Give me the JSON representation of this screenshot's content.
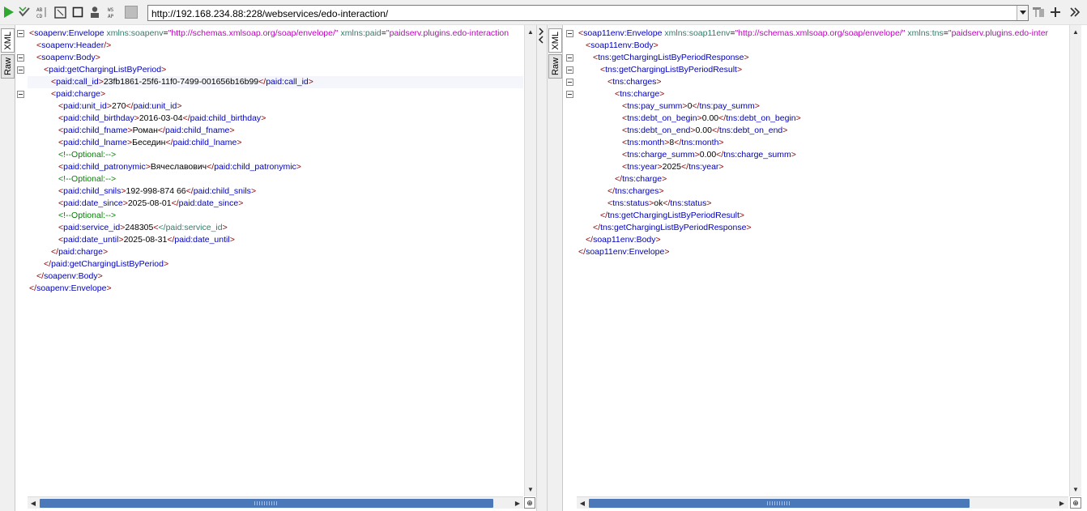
{
  "toolbar": {
    "url": "http://192.168.234.88:228/webservices/edo-interaction/",
    "icons": [
      "play-icon",
      "check-validate-icon",
      "format-icon",
      "fullscreen-icon",
      "stop-icon",
      "user-auth-icon",
      "wsa-icon",
      "wsdl-icon",
      "options-icon",
      "add-icon",
      "scroll-right-icon"
    ]
  },
  "request": {
    "tabs": [
      "XML",
      "Raw"
    ],
    "lines": [
      {
        "indent": 0,
        "parts": [
          [
            "t",
            "<"
          ],
          [
            "n",
            "soapenv:Envelope"
          ],
          [
            "a",
            " xmlns:soapenv"
          ],
          [
            "x",
            "="
          ],
          [
            "v",
            "\"http://schemas.xmlsoap.org/soap/envelope/\""
          ],
          [
            "a",
            " xmlns:paid"
          ],
          [
            "x",
            "="
          ],
          [
            "v",
            "\"paidserv.plugins.edo-interaction"
          ]
        ]
      },
      {
        "indent": 1,
        "parts": [
          [
            "t",
            "<"
          ],
          [
            "n",
            "soapenv:Header"
          ],
          [
            "t",
            "/>"
          ]
        ]
      },
      {
        "indent": 1,
        "parts": [
          [
            "t",
            "<"
          ],
          [
            "n",
            "soapenv:Body"
          ],
          [
            "t",
            ">"
          ]
        ]
      },
      {
        "indent": 2,
        "parts": [
          [
            "t",
            "<"
          ],
          [
            "n",
            "paid:getChargingListByPeriod"
          ],
          [
            "t",
            ">"
          ]
        ]
      },
      {
        "indent": 3,
        "parts": [
          [
            "t",
            "<"
          ],
          [
            "n",
            "paid:call_id"
          ],
          [
            "t",
            ">"
          ],
          [
            "x",
            "23fb1861-25f6-11f0-7499-001656b16b99"
          ],
          [
            "t",
            "</"
          ],
          [
            "n",
            "paid:call_id"
          ],
          [
            "t",
            ">"
          ]
        ]
      },
      {
        "indent": 3,
        "parts": [
          [
            "t",
            "<"
          ],
          [
            "n",
            "paid:charge"
          ],
          [
            "t",
            ">"
          ]
        ]
      },
      {
        "indent": 4,
        "parts": [
          [
            "t",
            "<"
          ],
          [
            "n",
            "paid:unit_id"
          ],
          [
            "t",
            ">"
          ],
          [
            "x",
            "270"
          ],
          [
            "t",
            "</"
          ],
          [
            "n",
            "paid:unit_id"
          ],
          [
            "t",
            ">"
          ]
        ]
      },
      {
        "indent": 4,
        "parts": [
          [
            "t",
            "<"
          ],
          [
            "n",
            "paid:child_birthday"
          ],
          [
            "t",
            ">"
          ],
          [
            "x",
            "2016-03-04"
          ],
          [
            "t",
            "</"
          ],
          [
            "n",
            "paid:child_birthday"
          ],
          [
            "t",
            ">"
          ]
        ]
      },
      {
        "indent": 4,
        "parts": [
          [
            "t",
            "<"
          ],
          [
            "n",
            "paid:child_fname"
          ],
          [
            "t",
            ">"
          ],
          [
            "x",
            "Роман"
          ],
          [
            "t",
            "</"
          ],
          [
            "n",
            "paid:child_fname"
          ],
          [
            "t",
            ">"
          ]
        ]
      },
      {
        "indent": 4,
        "parts": [
          [
            "t",
            "<"
          ],
          [
            "n",
            "paid:child_lname"
          ],
          [
            "t",
            ">"
          ],
          [
            "x",
            "Беседин"
          ],
          [
            "t",
            "</"
          ],
          [
            "n",
            "paid:child_lname"
          ],
          [
            "t",
            ">"
          ]
        ]
      },
      {
        "indent": 4,
        "parts": [
          [
            "c",
            "<!--Optional:-->"
          ]
        ]
      },
      {
        "indent": 4,
        "parts": [
          [
            "t",
            "<"
          ],
          [
            "n",
            "paid:child_patronymic"
          ],
          [
            "t",
            ">"
          ],
          [
            "x",
            "Вячеславович"
          ],
          [
            "t",
            "</"
          ],
          [
            "n",
            "paid:child_patronymic"
          ],
          [
            "t",
            ">"
          ]
        ]
      },
      {
        "indent": 4,
        "parts": [
          [
            "c",
            "<!--Optional:-->"
          ]
        ]
      },
      {
        "indent": 4,
        "parts": [
          [
            "t",
            "<"
          ],
          [
            "n",
            "paid:child_snils"
          ],
          [
            "t",
            ">"
          ],
          [
            "x",
            "192-998-874 66"
          ],
          [
            "t",
            "</"
          ],
          [
            "n",
            "paid:child_snils"
          ],
          [
            "t",
            ">"
          ]
        ]
      },
      {
        "indent": 4,
        "parts": [
          [
            "t",
            "<"
          ],
          [
            "n",
            "paid:date_since"
          ],
          [
            "t",
            ">"
          ],
          [
            "x",
            "2025-08-01"
          ],
          [
            "t",
            "</"
          ],
          [
            "n",
            "paid:date_since"
          ],
          [
            "t",
            ">"
          ]
        ]
      },
      {
        "indent": 4,
        "parts": [
          [
            "c",
            "<!--Optional:-->"
          ]
        ]
      },
      {
        "indent": 4,
        "parts": [
          [
            "t",
            "<"
          ],
          [
            "n",
            "paid:service_id"
          ],
          [
            "t",
            ">"
          ],
          [
            "x",
            "248305"
          ],
          [
            "t",
            "<"
          ],
          [
            "a",
            "</paid:service_id"
          ],
          [
            "t",
            ">"
          ]
        ]
      },
      {
        "indent": 4,
        "parts": [
          [
            "t",
            "<"
          ],
          [
            "n",
            "paid:date_until"
          ],
          [
            "t",
            ">"
          ],
          [
            "x",
            "2025-08-31"
          ],
          [
            "t",
            "</"
          ],
          [
            "n",
            "paid:date_until"
          ],
          [
            "t",
            ">"
          ]
        ]
      },
      {
        "indent": 3,
        "parts": [
          [
            "t",
            "</"
          ],
          [
            "n",
            "paid:charge"
          ],
          [
            "t",
            ">"
          ]
        ]
      },
      {
        "indent": 2,
        "parts": [
          [
            "t",
            "</"
          ],
          [
            "n",
            "paid:getChargingListByPeriod"
          ],
          [
            "t",
            ">"
          ]
        ]
      },
      {
        "indent": 1,
        "parts": [
          [
            "t",
            "</"
          ],
          [
            "n",
            "soapenv:Body"
          ],
          [
            "t",
            ">"
          ]
        ]
      },
      {
        "indent": 0,
        "parts": [
          [
            "t",
            "</"
          ],
          [
            "n",
            "soapenv:Envelope"
          ],
          [
            "t",
            ">"
          ]
        ]
      }
    ]
  },
  "response": {
    "tabs": [
      "XML",
      "Raw"
    ],
    "lines": [
      {
        "indent": 0,
        "parts": [
          [
            "t",
            "<"
          ],
          [
            "n",
            "soap11env:Envelope"
          ],
          [
            "a",
            " xmlns:soap11env"
          ],
          [
            "x",
            "="
          ],
          [
            "v",
            "\"http://schemas.xmlsoap.org/soap/envelope/\""
          ],
          [
            "a",
            " xmlns:tns"
          ],
          [
            "x",
            "="
          ],
          [
            "v",
            "\"paidserv.plugins.edo-inter"
          ]
        ]
      },
      {
        "indent": 1,
        "parts": [
          [
            "t",
            "<"
          ],
          [
            "n",
            "soap11env:Body"
          ],
          [
            "t",
            ">"
          ]
        ]
      },
      {
        "indent": 2,
        "parts": [
          [
            "t",
            "<"
          ],
          [
            "n",
            "tns:getChargingListByPeriodResponse"
          ],
          [
            "t",
            ">"
          ]
        ]
      },
      {
        "indent": 3,
        "parts": [
          [
            "t",
            "<"
          ],
          [
            "n",
            "tns:getChargingListByPeriodResult"
          ],
          [
            "t",
            ">"
          ]
        ]
      },
      {
        "indent": 4,
        "parts": [
          [
            "t",
            "<"
          ],
          [
            "n",
            "tns:charges"
          ],
          [
            "t",
            ">"
          ]
        ]
      },
      {
        "indent": 5,
        "parts": [
          [
            "t",
            "<"
          ],
          [
            "n",
            "tns:charge"
          ],
          [
            "t",
            ">"
          ]
        ]
      },
      {
        "indent": 6,
        "parts": [
          [
            "t",
            "<"
          ],
          [
            "n",
            "tns:pay_summ"
          ],
          [
            "t",
            ">"
          ],
          [
            "x",
            "0"
          ],
          [
            "t",
            "</"
          ],
          [
            "n",
            "tns:pay_summ"
          ],
          [
            "t",
            ">"
          ]
        ]
      },
      {
        "indent": 6,
        "parts": [
          [
            "t",
            "<"
          ],
          [
            "n",
            "tns:debt_on_begin"
          ],
          [
            "t",
            ">"
          ],
          [
            "x",
            "0.00"
          ],
          [
            "t",
            "</"
          ],
          [
            "n",
            "tns:debt_on_begin"
          ],
          [
            "t",
            ">"
          ]
        ]
      },
      {
        "indent": 6,
        "parts": [
          [
            "t",
            "<"
          ],
          [
            "n",
            "tns:debt_on_end"
          ],
          [
            "t",
            ">"
          ],
          [
            "x",
            "0.00"
          ],
          [
            "t",
            "</"
          ],
          [
            "n",
            "tns:debt_on_end"
          ],
          [
            "t",
            ">"
          ]
        ]
      },
      {
        "indent": 6,
        "parts": [
          [
            "t",
            "<"
          ],
          [
            "n",
            "tns:month"
          ],
          [
            "t",
            ">"
          ],
          [
            "x",
            "8"
          ],
          [
            "t",
            "</"
          ],
          [
            "n",
            "tns:month"
          ],
          [
            "t",
            ">"
          ]
        ]
      },
      {
        "indent": 6,
        "parts": [
          [
            "t",
            "<"
          ],
          [
            "n",
            "tns:charge_summ"
          ],
          [
            "t",
            ">"
          ],
          [
            "x",
            "0.00"
          ],
          [
            "t",
            "</"
          ],
          [
            "n",
            "tns:charge_summ"
          ],
          [
            "t",
            ">"
          ]
        ]
      },
      {
        "indent": 6,
        "parts": [
          [
            "t",
            "<"
          ],
          [
            "n",
            "tns:year"
          ],
          [
            "t",
            ">"
          ],
          [
            "x",
            "2025"
          ],
          [
            "t",
            "</"
          ],
          [
            "n",
            "tns:year"
          ],
          [
            "t",
            ">"
          ]
        ]
      },
      {
        "indent": 5,
        "parts": [
          [
            "t",
            "</"
          ],
          [
            "n",
            "tns:charge"
          ],
          [
            "t",
            ">"
          ]
        ]
      },
      {
        "indent": 4,
        "parts": [
          [
            "t",
            "</"
          ],
          [
            "n",
            "tns:charges"
          ],
          [
            "t",
            ">"
          ]
        ]
      },
      {
        "indent": 4,
        "parts": [
          [
            "t",
            "<"
          ],
          [
            "n",
            "tns:status"
          ],
          [
            "t",
            ">"
          ],
          [
            "x",
            "ok"
          ],
          [
            "t",
            "</"
          ],
          [
            "n",
            "tns:status"
          ],
          [
            "t",
            ">"
          ]
        ]
      },
      {
        "indent": 3,
        "parts": [
          [
            "t",
            "</"
          ],
          [
            "n",
            "tns:getChargingListByPeriodResult"
          ],
          [
            "t",
            ">"
          ]
        ]
      },
      {
        "indent": 2,
        "parts": [
          [
            "t",
            "</"
          ],
          [
            "n",
            "tns:getChargingListByPeriodResponse"
          ],
          [
            "t",
            ">"
          ]
        ]
      },
      {
        "indent": 1,
        "parts": [
          [
            "t",
            "</"
          ],
          [
            "n",
            "soap11env:Body"
          ],
          [
            "t",
            ">"
          ]
        ]
      },
      {
        "indent": 0,
        "parts": [
          [
            "t",
            "</"
          ],
          [
            "n",
            "soap11env:Envelope"
          ],
          [
            "t",
            ">"
          ]
        ]
      }
    ]
  },
  "colors": {
    "tag_bracket": "#8a0000",
    "tag_name": "#0000c0",
    "attr_name": "#2e7d6b",
    "attr_value": "#c000c0",
    "comment": "#008000",
    "scroll_thumb": "#4a78b8"
  }
}
